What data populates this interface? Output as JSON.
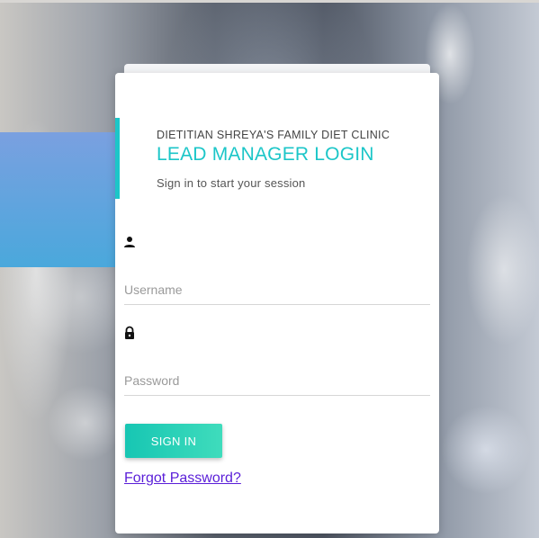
{
  "login": {
    "clinic_name": "DIETITIAN SHREYA'S FAMILY DIET CLINIC",
    "title": "LEAD MANAGER LOGIN",
    "subtitle": "Sign in to start your session",
    "username_placeholder": "Username",
    "username_value": "",
    "password_placeholder": "Password",
    "password_value": "",
    "signin_label": "SIGN IN",
    "forgot_label": "Forgot Password?"
  },
  "icons": {
    "username": "person-icon",
    "password": "lock-icon"
  },
  "colors": {
    "accent": "#1cc6c8",
    "button": "#17c6b3",
    "link": "#5a1ed8",
    "side_block": "#4aa8dc"
  }
}
